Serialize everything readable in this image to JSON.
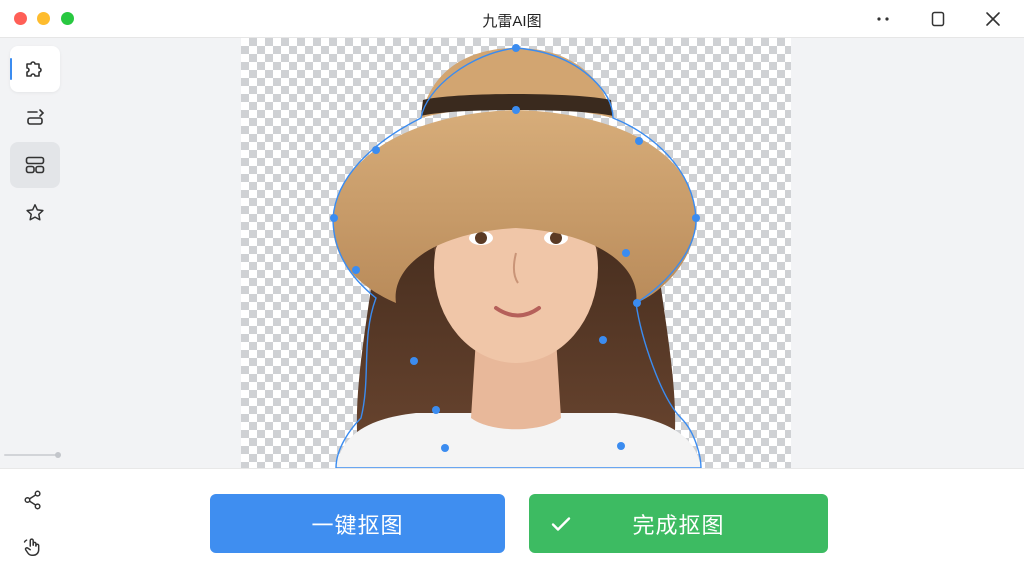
{
  "window": {
    "title": "九雷AI图"
  },
  "sidebar": {
    "tools": [
      {
        "icon": "puzzle-icon",
        "state": "active"
      },
      {
        "icon": "text-edit-icon",
        "state": "normal"
      },
      {
        "icon": "layout-grid-icon",
        "state": "selected"
      },
      {
        "icon": "star-icon",
        "state": "normal"
      }
    ]
  },
  "bottom": {
    "icons": [
      "share-icon",
      "hand-touch-icon"
    ],
    "one_click_label": "一键抠图",
    "done_label": "完成抠图"
  },
  "colors": {
    "primary_blue": "#3f8ef0",
    "confirm_green": "#3dbb62",
    "selection_outline": "#3b8cf0"
  }
}
